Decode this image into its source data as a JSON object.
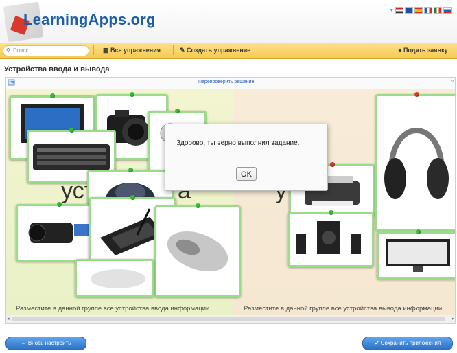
{
  "header": {
    "logo_text": "LearningApps.org",
    "flags": [
      "#c62828",
      "#1f4fa8",
      "#f5b800",
      "#2e7d32",
      "#d32f2f",
      "#1565c0"
    ]
  },
  "toolbar": {
    "search_placeholder": "Поиск",
    "all_exercises": "Все упражнения",
    "create_exercise": "Создать упражнение",
    "submit_request": "Подать заявку"
  },
  "page_title": "Устройства ввода и вывода",
  "app": {
    "recheck_link": "Перепроверить решение",
    "right_mark": "?",
    "watermark_left": "устр",
    "watermark_mid": "а",
    "watermark_right": "у",
    "left_zone_label": "Разместите в данной группе все устройства ввода информации",
    "right_zone_label": "Разместите в данной группе все устройства вывода информации",
    "cards": [
      {
        "item": "monitor",
        "pin": "green"
      },
      {
        "item": "camera",
        "pin": "green"
      },
      {
        "item": "webcam",
        "pin": "green"
      },
      {
        "item": "keyboard",
        "pin": "green"
      },
      {
        "item": "trackball",
        "pin": "green"
      },
      {
        "item": "camcorder",
        "pin": "green"
      },
      {
        "item": "tablet",
        "pin": "green"
      },
      {
        "item": "mouse",
        "pin": "green"
      },
      {
        "item": "printer",
        "pin": "red"
      },
      {
        "item": "speakers",
        "pin": "green"
      },
      {
        "item": "headphones",
        "pin": "red"
      },
      {
        "item": "monitor-output",
        "pin": "green"
      }
    ]
  },
  "dialog": {
    "message": "Здорово, ты верно выполнил задание.",
    "ok_label": "OK"
  },
  "buttons": {
    "reconfigure": "Вновь настроить",
    "save_app": "Сохранить приложения"
  },
  "colors": {
    "toolbar": "#f4c94e",
    "card_border": "#9bdc8a",
    "button_blue": "#2b6fc4",
    "logo_blue": "#1d5ea8"
  }
}
